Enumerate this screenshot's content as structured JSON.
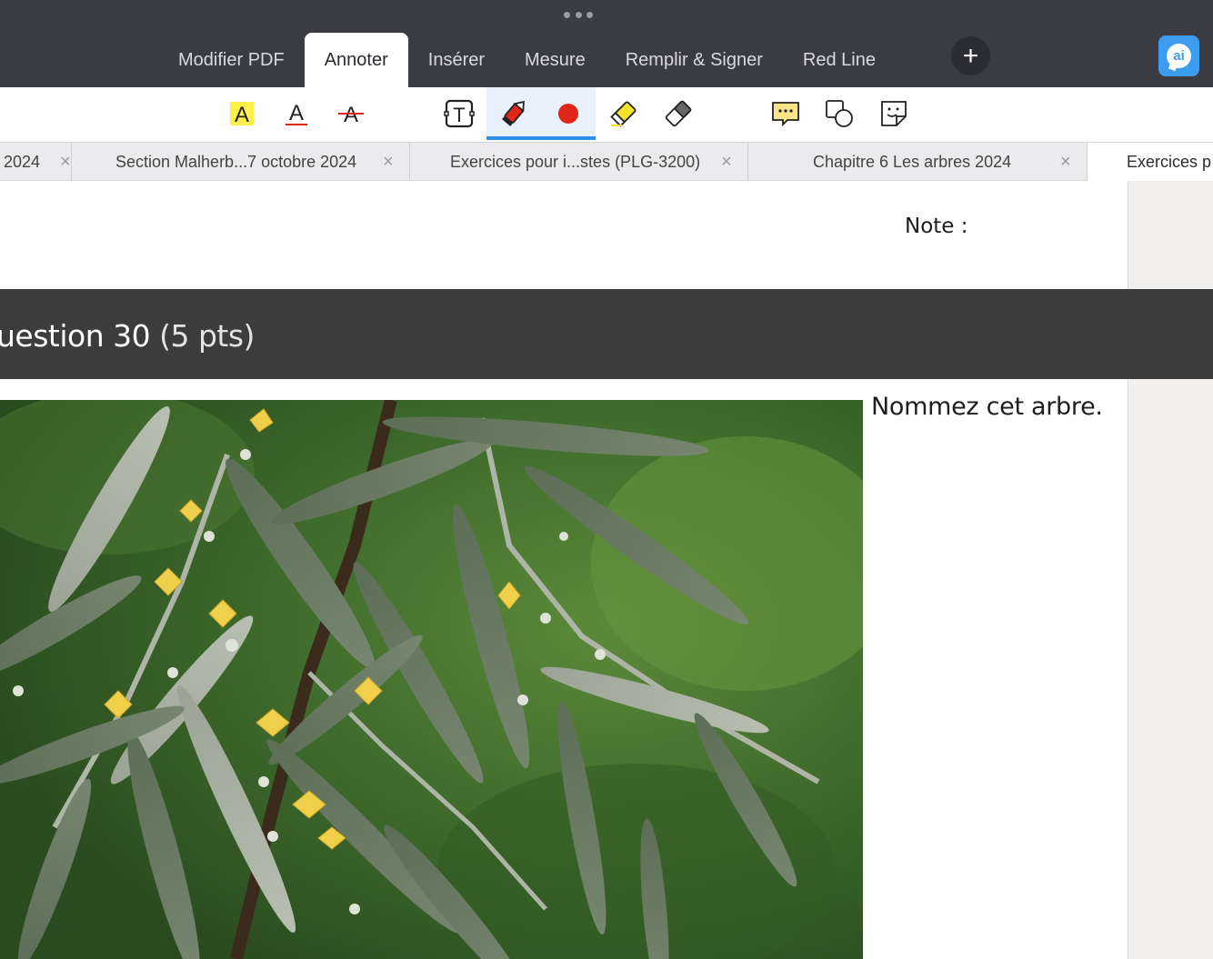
{
  "app": {
    "tabs": [
      {
        "label": "Modifier PDF",
        "active": false
      },
      {
        "label": "Annoter",
        "active": true
      },
      {
        "label": "Insérer",
        "active": false
      },
      {
        "label": "Mesure",
        "active": false
      },
      {
        "label": "Remplir & Signer",
        "active": false
      },
      {
        "label": "Red Line",
        "active": false
      }
    ],
    "add_tab_icon": "plus-icon",
    "ai_button_label": "ai",
    "accent_color": "#2f8fe6"
  },
  "toolbar": {
    "tools": [
      {
        "name": "highlight-text-icon",
        "label": "A"
      },
      {
        "name": "underline-text-icon",
        "label": "A"
      },
      {
        "name": "strikethrough-text-icon",
        "label": "A"
      },
      {
        "name": "text-box-icon",
        "label": "T"
      },
      {
        "name": "pen-icon",
        "label": ""
      },
      {
        "name": "color-dot-icon",
        "label": ""
      },
      {
        "name": "highlighter-icon",
        "label": ""
      },
      {
        "name": "eraser-icon",
        "label": ""
      },
      {
        "name": "comment-icon",
        "label": ""
      },
      {
        "name": "shapes-icon",
        "label": ""
      },
      {
        "name": "sticker-icon",
        "label": ""
      }
    ],
    "active_tool": "pen-icon",
    "pen_color": "#e02618"
  },
  "doc_tabs": [
    {
      "label": "2024",
      "active": false
    },
    {
      "label": "Section Malherb...7 octobre 2024",
      "active": false
    },
    {
      "label": "Exercices pour i...stes (PLG-3200)",
      "active": false
    },
    {
      "label": "Chapitre 6 Les arbres  2024",
      "active": false
    },
    {
      "label": "Exercices p",
      "active": true
    }
  ],
  "document": {
    "note_label": "Note :",
    "question_title": "uestion 30",
    "question_points": "(5 pts)",
    "question_text": "Nommez cet arbre."
  }
}
